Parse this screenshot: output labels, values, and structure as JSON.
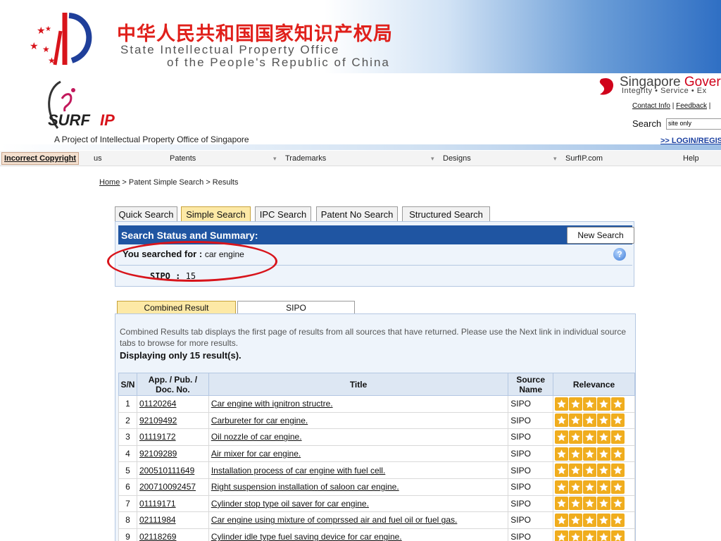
{
  "banner": {
    "cn_title": "中华人民共和国国家知识产权局",
    "en_line1": "State Intellectual Property Office",
    "en_line2": "of the People's Republic of China"
  },
  "surfip": {
    "logo_text": "SURF IP",
    "subtitle": "A Project of Intellectual Property Office of Singapore"
  },
  "singapore": {
    "title_a": "Singapore",
    "title_b": "Gover",
    "tagline": "Integrity • Service • Ex",
    "links": [
      "Contact Info",
      "Feedback"
    ],
    "link_sep": "|",
    "search_label": "Search",
    "search_value": "site only",
    "login": ">> LOGIN/REGIS"
  },
  "nav": {
    "incorrect_copyright": "Incorrect Copyright",
    "items": [
      "us",
      "Patents",
      "Trademarks",
      "Designs",
      "SurfIP.com",
      "Help"
    ]
  },
  "breadcrumb": {
    "home": "Home",
    "rest": " > Patent Simple Search > Results"
  },
  "search_tabs": [
    "Quick Search",
    "Simple Search",
    "IPC Search",
    "Patent No Search",
    "Structured Search"
  ],
  "summary": {
    "title": "Search Status and Summary:",
    "new_search": "New Search",
    "searched_label": "You searched for :",
    "query": "car engine",
    "sipo_label": "SIPO :",
    "sipo_count": "15"
  },
  "result_tabs": [
    "Combined Result",
    "SIPO"
  ],
  "results": {
    "note": "Combined Results tab displays the first page of results from all sources that have returned. Please use the Next link in individual source tabs to browse for more results.",
    "count_text": "Displaying only 15 result(s).",
    "headers": [
      "S/N",
      "App. / Pub. / Doc. No.",
      "Title",
      "Source Name",
      "Relevance"
    ],
    "rows": [
      {
        "sn": "1",
        "no": "01120264",
        "title": "Car engine with ignitron structre.",
        "source": "SIPO",
        "stars": 5
      },
      {
        "sn": "2",
        "no": "92109492",
        "title": "Carbureter for car engine.",
        "source": "SIPO",
        "stars": 5
      },
      {
        "sn": "3",
        "no": "01119172",
        "title": "Oil nozzle of car engine.",
        "source": "SIPO",
        "stars": 5
      },
      {
        "sn": "4",
        "no": "92109289",
        "title": "Air mixer for car engine.",
        "source": "SIPO",
        "stars": 5
      },
      {
        "sn": "5",
        "no": "200510111649",
        "title": "Installation process of car engine with fuel cell.",
        "source": "SIPO",
        "stars": 5
      },
      {
        "sn": "6",
        "no": "200710092457",
        "title": "Right suspension installation of saloon car engine.",
        "source": "SIPO",
        "stars": 5
      },
      {
        "sn": "7",
        "no": "01119171",
        "title": "Cylinder stop type oil saver for car engine.",
        "source": "SIPO",
        "stars": 5
      },
      {
        "sn": "8",
        "no": "02111984",
        "title": "Car engine using mixture of comprssed air and fuel oil or fuel gas.",
        "source": "SIPO",
        "stars": 5
      },
      {
        "sn": "9",
        "no": "02118269",
        "title": "Cylinder idle type fuel saving device for car engine.",
        "source": "SIPO",
        "stars": 5
      }
    ]
  },
  "colors": {
    "header_blue": "#1f55a2",
    "active_tab": "#fde9a6",
    "star": "#f0ad1e",
    "highlight_ellipse": "#d8141b",
    "cn_title": "#e0201b"
  }
}
